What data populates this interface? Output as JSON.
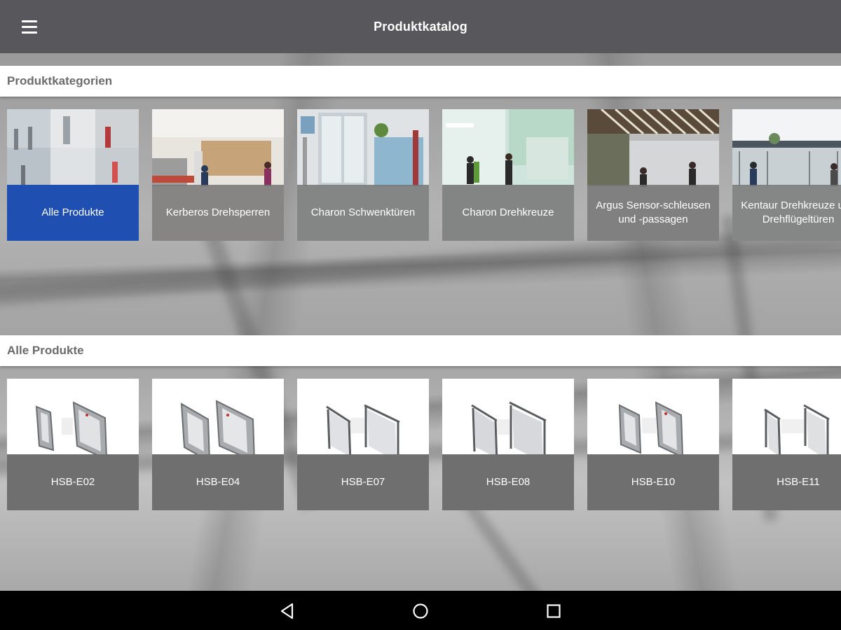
{
  "app": {
    "title": "Produktkatalog"
  },
  "icons": {
    "menu": "menu-icon",
    "back": "back-icon",
    "home": "home-icon",
    "recents": "recents-icon"
  },
  "colors": {
    "topbar": "#58585c",
    "accent": "#1f4fb0",
    "header_text": "#6b6b6b"
  },
  "categories": {
    "title": "Produktkategorien",
    "items": [
      {
        "label": "Alle Produkte",
        "selected": true
      },
      {
        "label": "Kerberos Drehsperren"
      },
      {
        "label": "Charon Schwenktüren"
      },
      {
        "label": "Charon Drehkreuze"
      },
      {
        "label": "Argus Sensor-schleusen und -passagen"
      },
      {
        "label": "Kentaur Drehkreuze und Drehflügeltüren"
      }
    ]
  },
  "products": {
    "title": "Alle Produkte",
    "items": [
      {
        "label": "HSB-E02"
      },
      {
        "label": "HSB-E04"
      },
      {
        "label": "HSB-E07"
      },
      {
        "label": "HSB-E08"
      },
      {
        "label": "HSB-E10"
      },
      {
        "label": "HSB-E11"
      }
    ]
  }
}
